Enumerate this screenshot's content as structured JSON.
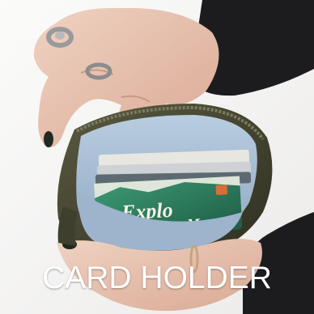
{
  "caption": "CARD HOLDER",
  "card": {
    "printed_text": "Explo",
    "printed_text_2": "M"
  },
  "colors": {
    "background": "#f4f3f2",
    "sleeve": "#1c1c1f",
    "skin": "#e9c7b6",
    "nail_polish": "#1f2a22",
    "pouch_shell": "#4a4a35",
    "pouch_lining": "#a9bfd6",
    "card_green": "#2f7d5f",
    "caption_text": "#ffffff"
  }
}
